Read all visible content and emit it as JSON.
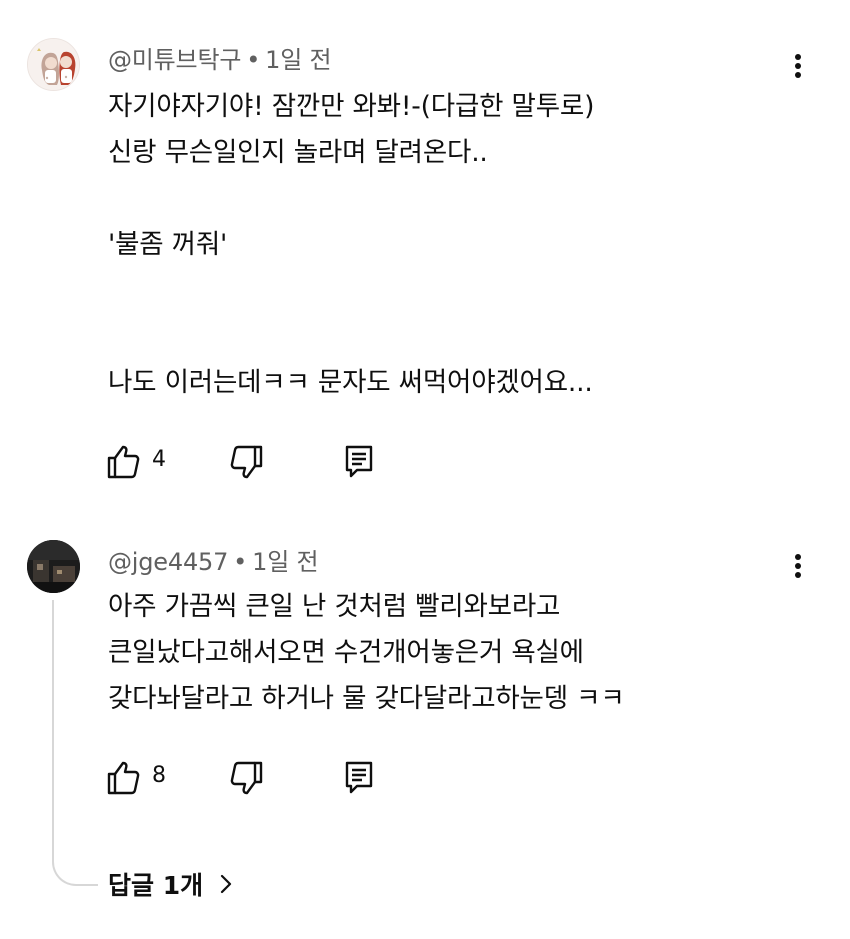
{
  "comments": [
    {
      "author": "@미튜브탁구",
      "separator": "•",
      "time": "1일 전",
      "text": "자기야자기야! 잠깐만 와봐!-(다급한 말투로)\n신랑 무슨일인지 놀라며 달려온다..\n\n'불좀 꺼줘'\n\n\n나도 이러는데ㅋㅋ 문자도 써먹어야겠어요...",
      "likes": "4",
      "icons": {
        "like": "thumbs-up-icon",
        "dislike": "thumbs-down-icon",
        "reply": "reply-icon",
        "more": "more-vert-icon"
      }
    },
    {
      "author": "@jge4457",
      "separator": "•",
      "time": "1일 전",
      "text": "아주 가끔씩 큰일 난 것처럼 빨리와보라고\n큰일났다고해서오면 수건개어놓은거 욕실에\n갖다놔달라고 하거나 물 갖다달라고하눈뎅 ㅋㅋ",
      "likes": "8",
      "icons": {
        "like": "thumbs-up-icon",
        "dislike": "thumbs-down-icon",
        "reply": "reply-icon",
        "more": "more-vert-icon"
      }
    }
  ],
  "replies": {
    "label": "답글 1개",
    "icon": "chevron-right-icon"
  },
  "colors": {
    "text": "#0f0f0f",
    "meta": "#606060",
    "thread_line": "#d7d7d7"
  }
}
